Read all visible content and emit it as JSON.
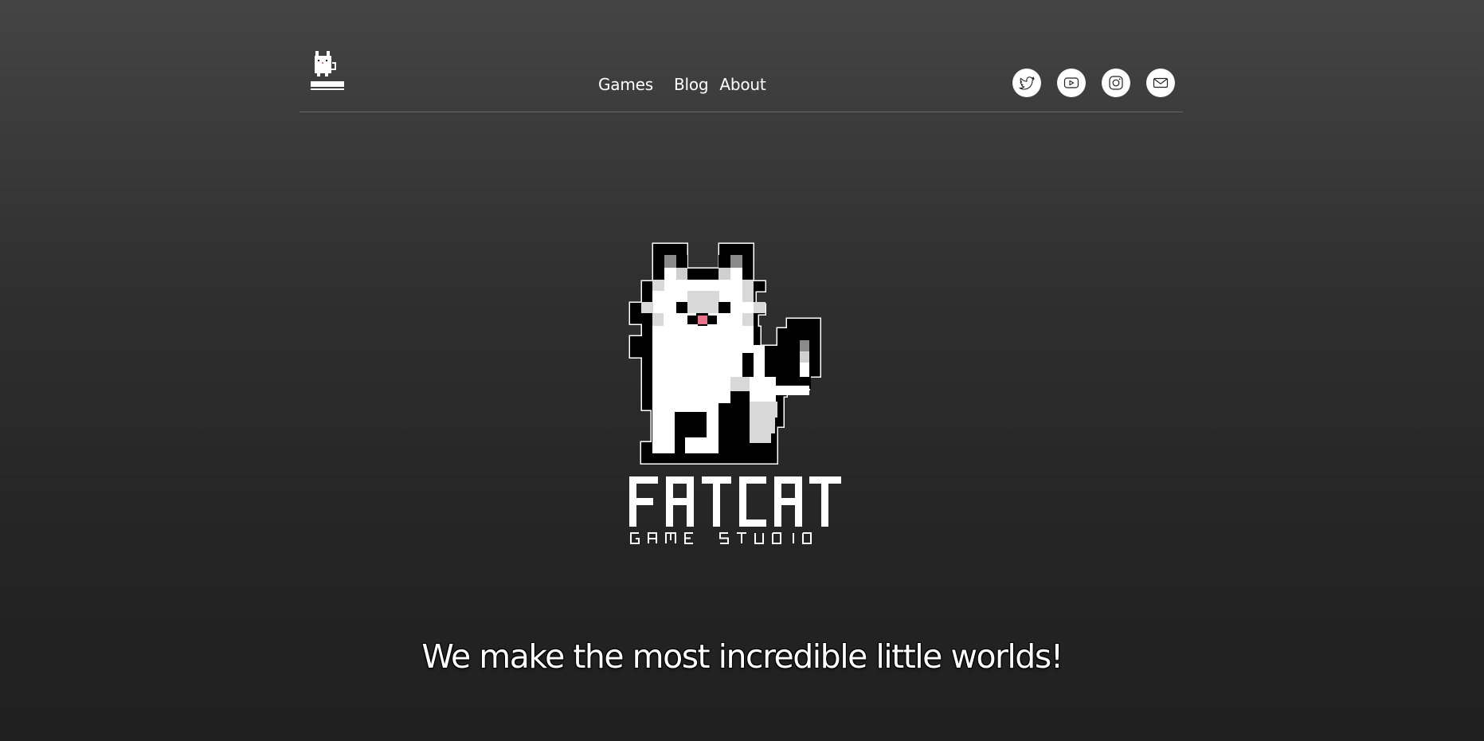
{
  "header": {
    "nav": {
      "games": "Games",
      "blog": "Blog",
      "about": "About"
    },
    "social": [
      {
        "icon": "twitter-icon",
        "label": "Twitter"
      },
      {
        "icon": "youtube-icon",
        "label": "YouTube"
      },
      {
        "icon": "instagram-icon",
        "label": "Instagram"
      },
      {
        "icon": "mail-icon",
        "label": "Email"
      }
    ]
  },
  "hero": {
    "brand_name": "FATCAT",
    "brand_sub": "GAME STUDIO",
    "tagline": "We make the most incredible little worlds!"
  },
  "colors": {
    "background_top": "#444444",
    "background_bottom": "#202020",
    "accent_tongue": "#e8728a",
    "text": "#ffffff"
  }
}
